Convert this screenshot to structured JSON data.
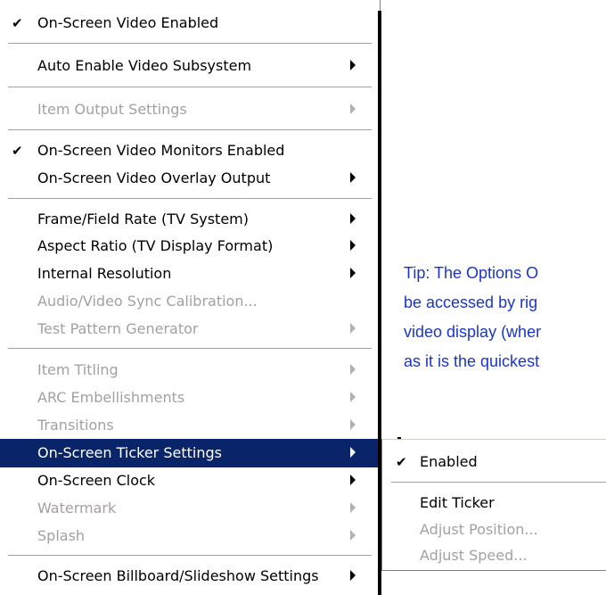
{
  "menu": {
    "items": [
      {
        "label": "On-Screen Video Enabled",
        "checked": true,
        "submenu": false,
        "disabled": false
      },
      {
        "label": "Auto Enable Video Subsystem",
        "checked": false,
        "submenu": true,
        "disabled": false
      },
      {
        "label": "Item Output Settings",
        "checked": false,
        "submenu": true,
        "disabled": true
      },
      {
        "label": "On-Screen Video Monitors Enabled",
        "checked": true,
        "submenu": false,
        "disabled": false
      },
      {
        "label": "On-Screen Video Overlay Output",
        "checked": false,
        "submenu": true,
        "disabled": false
      },
      {
        "label": "Frame/Field Rate (TV System)",
        "checked": false,
        "submenu": true,
        "disabled": false
      },
      {
        "label": "Aspect Ratio (TV Display Format)",
        "checked": false,
        "submenu": true,
        "disabled": false
      },
      {
        "label": "Internal Resolution",
        "checked": false,
        "submenu": true,
        "disabled": false
      },
      {
        "label": "Audio/Video Sync Calibration...",
        "checked": false,
        "submenu": false,
        "disabled": true
      },
      {
        "label": "Test Pattern Generator",
        "checked": false,
        "submenu": true,
        "disabled": true
      },
      {
        "label": "Item Titling",
        "checked": false,
        "submenu": true,
        "disabled": true
      },
      {
        "label": "ARC Embellishments",
        "checked": false,
        "submenu": true,
        "disabled": true
      },
      {
        "label": "Transitions",
        "checked": false,
        "submenu": true,
        "disabled": true
      },
      {
        "label": "On-Screen Ticker Settings",
        "checked": false,
        "submenu": true,
        "disabled": false,
        "selected": true
      },
      {
        "label": "On-Screen Clock",
        "checked": false,
        "submenu": true,
        "disabled": false
      },
      {
        "label": "Watermark",
        "checked": false,
        "submenu": true,
        "disabled": true
      },
      {
        "label": "Splash",
        "checked": false,
        "submenu": true,
        "disabled": true
      },
      {
        "label": "On-Screen Billboard/Slideshow Settings",
        "checked": false,
        "submenu": true,
        "disabled": false
      }
    ],
    "check_glyph": "✔"
  },
  "submenu": {
    "items": [
      {
        "label": "Enabled",
        "checked": true,
        "disabled": false
      },
      {
        "label": "Edit Ticker",
        "checked": false,
        "disabled": false
      },
      {
        "label": "Adjust Position...",
        "checked": false,
        "disabled": true
      },
      {
        "label": "Adjust Speed...",
        "checked": false,
        "disabled": true
      }
    ]
  },
  "tip": {
    "lines": [
      "Tip: The Options O",
      "be accessed by rig",
      "video display (wher",
      "as it is the quickest"
    ]
  },
  "colors": {
    "selection": "#0a246a",
    "disabled_text": "#a4a0a0",
    "tip_text": "#1a36c8"
  }
}
